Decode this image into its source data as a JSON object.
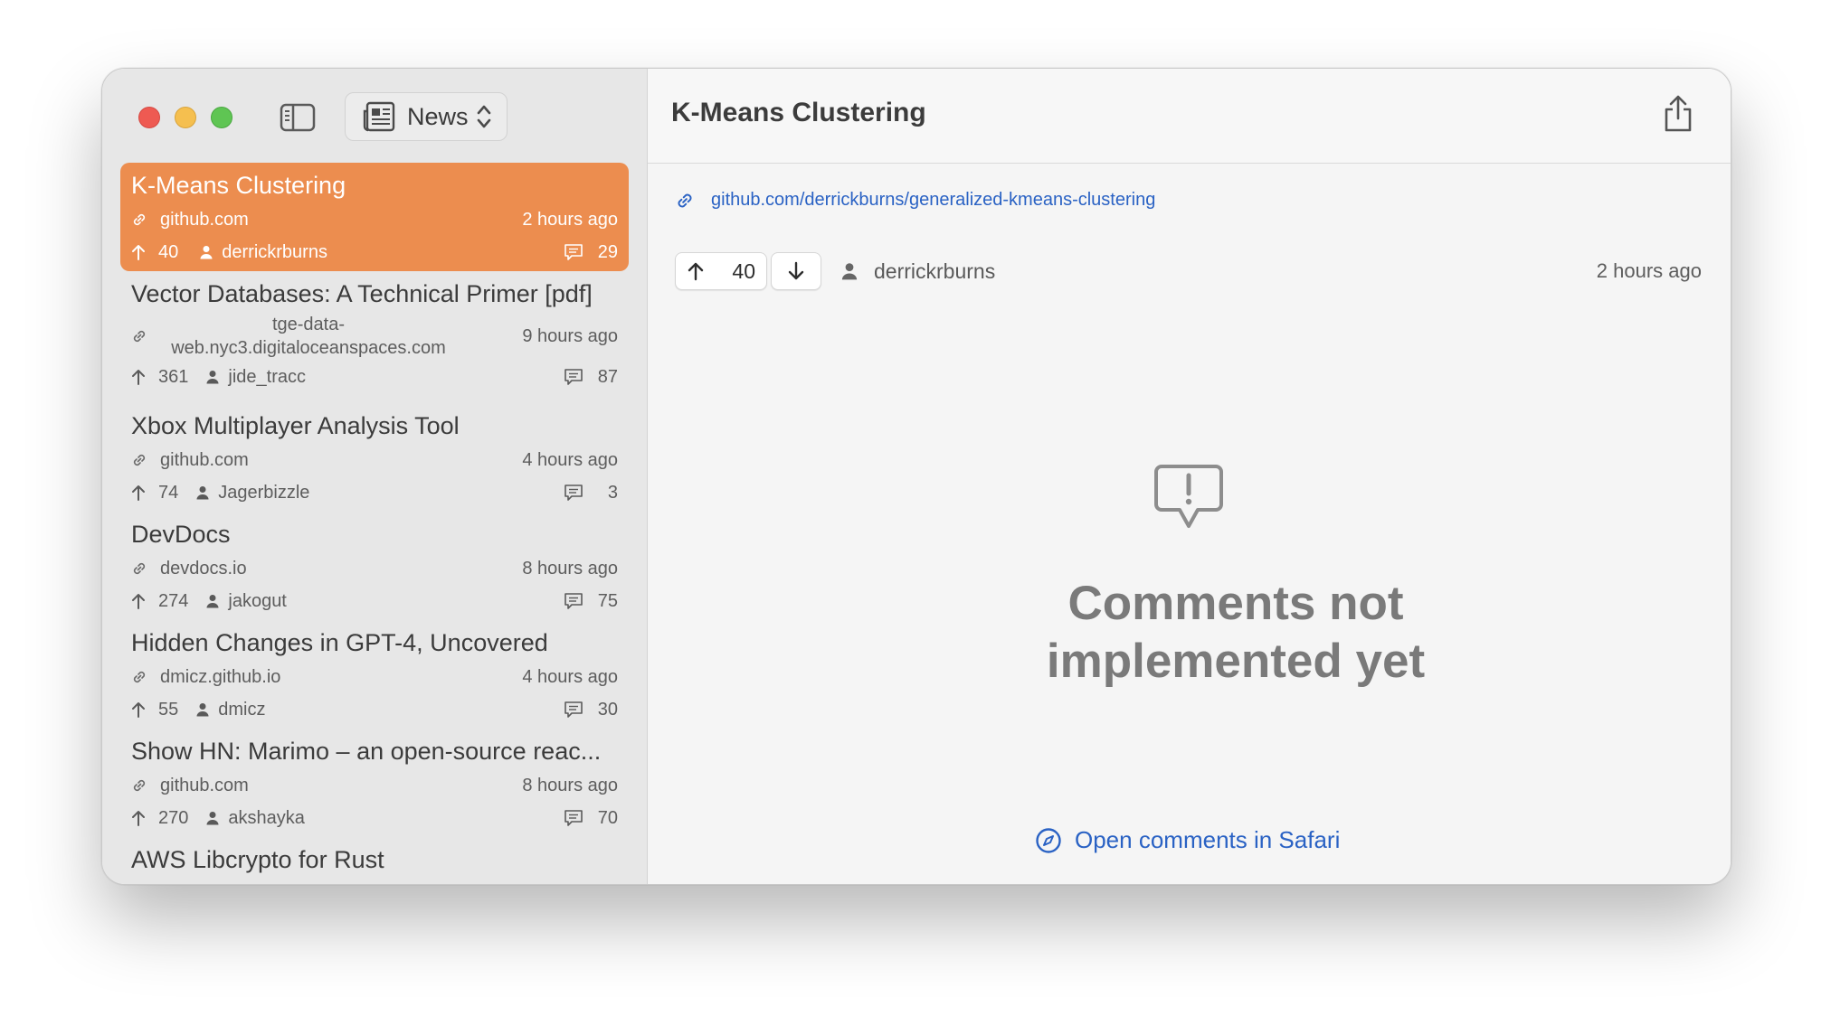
{
  "toolbar": {
    "feed_label": "News"
  },
  "stories": [
    {
      "title": "K-Means Clustering",
      "domain": "github.com",
      "time": "2 hours ago",
      "points": "40",
      "user": "derrickrburns",
      "comments": "29",
      "selected": true
    },
    {
      "title": "Vector Databases: A Technical Primer [pdf]",
      "domain_line1": "tge-data-",
      "domain_line2": "web.nyc3.digitaloceanspaces.com",
      "time": "9 hours ago",
      "points": "361",
      "user": "jide_tracc",
      "comments": "87"
    },
    {
      "title": "Xbox Multiplayer Analysis Tool",
      "domain": "github.com",
      "time": "4 hours ago",
      "points": "74",
      "user": "Jagerbizzle",
      "comments": "3"
    },
    {
      "title": "DevDocs",
      "domain": "devdocs.io",
      "time": "8 hours ago",
      "points": "274",
      "user": "jakogut",
      "comments": "75"
    },
    {
      "title": "Hidden Changes in GPT-4, Uncovered",
      "domain": "dmicz.github.io",
      "time": "4 hours ago",
      "points": "55",
      "user": "dmicz",
      "comments": "30"
    },
    {
      "title": "Show HN: Marimo – an open-source reac...",
      "domain": "github.com",
      "time": "8 hours ago",
      "points": "270",
      "user": "akshayka",
      "comments": "70"
    },
    {
      "title": "AWS Libcrypto for Rust"
    }
  ],
  "detail": {
    "title": "K-Means Clustering",
    "url": "github.com/derrickburns/generalized-kmeans-clustering",
    "score": "40",
    "author": "derrickrburns",
    "time": "2 hours ago",
    "empty_title": "Comments not implemented yet",
    "open_link": "Open comments in Safari"
  },
  "colors": {
    "accent": "#ec8d4f",
    "link": "#2a62c4",
    "close": "#ee5a52",
    "minimize": "#f5bf4f",
    "maximize": "#5fc553"
  },
  "icons": [
    "sidebar-toggle-icon",
    "newspaper-icon",
    "chevron-up-down-icon",
    "link-icon",
    "arrow-up-icon",
    "arrow-down-icon",
    "person-icon",
    "comment-icon",
    "share-icon",
    "exclamation-bubble-icon",
    "compass-icon"
  ]
}
